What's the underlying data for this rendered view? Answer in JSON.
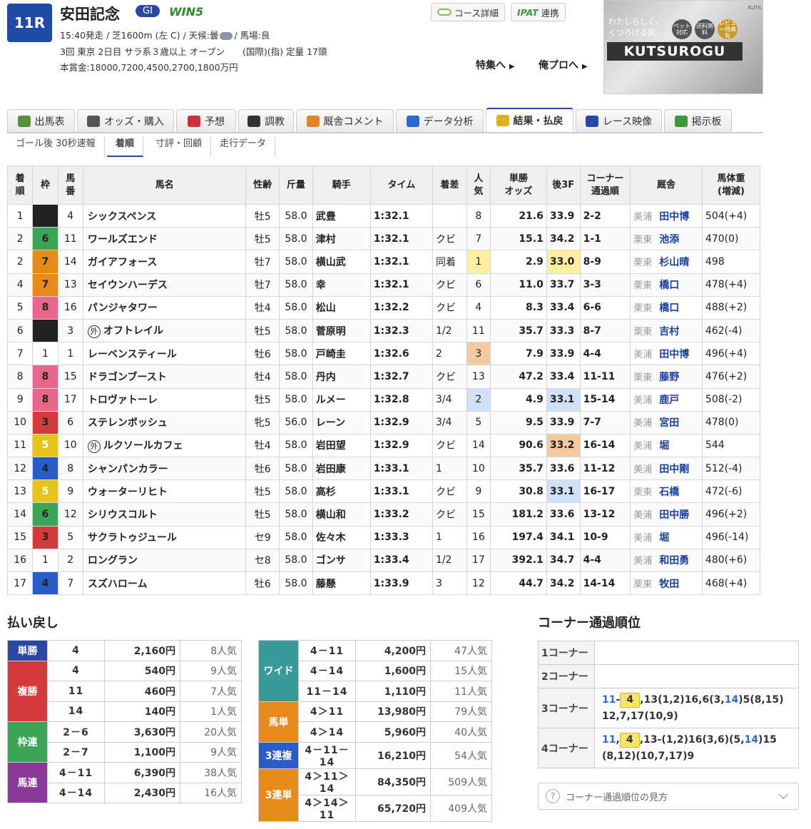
{
  "header": {
    "race_no": "11R",
    "race_name": "安田記念",
    "grade": "GI",
    "win5": "WIN5",
    "line1_pre": "15:40発走 / 芝1600m (左 C) / 天候:曇",
    "line1_post": "/ 馬場:良",
    "line2": "3回 東京 2日目 サラ系３歳以上 オープン　　(国際)(指) 定量 17頭",
    "line3": "本賞金:18000,7200,4500,2700,1800万円",
    "course_btn": "コース詳細",
    "ipat_logo": "IPAT",
    "ipat_btn": "連携",
    "feature_link": "特集へ",
    "orepro_link": "俺プロへ"
  },
  "ad": {
    "copy1": "わたしらしく、",
    "copy2": "くつろげる床。",
    "brand": "KUTSUROGU",
    "tag1": "ペット対応",
    "tag2": "送料無料",
    "tag3": "レビュー特典有",
    "side": "KUTS"
  },
  "tabs": [
    {
      "label": "出馬表",
      "color": "#5a8f3d"
    },
    {
      "label": "オッズ・購入",
      "color": "#555"
    },
    {
      "label": "予想",
      "color": "#d0303a"
    },
    {
      "label": "調教",
      "color": "#333"
    },
    {
      "label": "厩舎コメント",
      "color": "#e0852a"
    },
    {
      "label": "データ分析",
      "color": "#2a6ad0"
    },
    {
      "label": "結果・払戻",
      "color": "#e0b020"
    },
    {
      "label": "レース映像",
      "color": "#2a49a6"
    },
    {
      "label": "掲示板",
      "color": "#3a9a3a"
    }
  ],
  "subtabs": [
    "ゴール後 30秒速報",
    "着順",
    "寸評・回顧",
    "走行データ"
  ],
  "columns": [
    "着\n順",
    "枠",
    "馬\n番",
    "馬名",
    "性齢",
    "斤量",
    "騎手",
    "タイム",
    "着差",
    "人\n気",
    "単勝\nオッズ",
    "後3F",
    "コーナー\n通過順",
    "厩舎",
    "馬体重\n(増減)"
  ],
  "waku_colors": {
    "1": "#ffffff",
    "2": "#222222",
    "3": "#d63b3b",
    "4": "#2a5bc8",
    "5": "#e8c31a",
    "6": "#3aa655",
    "7": "#e88a1a",
    "8": "#e8668a"
  },
  "results": [
    {
      "pos": "1",
      "waku": "2",
      "num": "4",
      "name": "シックスペンス",
      "gai": false,
      "sex": "牡5",
      "wt": "58.0",
      "jockey": "武豊",
      "time": "1:32.1",
      "margin": "",
      "pop": "8",
      "odds": "21.6",
      "odds_red": false,
      "last3f": "33.9",
      "corner": "2-2",
      "region": "美浦",
      "trainer": "田中博",
      "bw": "504(+4)",
      "pop_hl": "",
      "f3_hl": ""
    },
    {
      "pos": "2",
      "waku": "6",
      "num": "11",
      "name": "ワールズエンド",
      "gai": false,
      "sex": "牡5",
      "wt": "58.0",
      "jockey": "津村",
      "time": "1:32.1",
      "margin": "クビ",
      "pop": "7",
      "odds": "15.1",
      "odds_red": false,
      "last3f": "34.2",
      "corner": "1-1",
      "region": "栗東",
      "trainer": "池添",
      "bw": "470(0)",
      "pop_hl": "",
      "f3_hl": ""
    },
    {
      "pos": "2",
      "waku": "7",
      "num": "14",
      "name": "ガイアフォース",
      "gai": false,
      "sex": "牡7",
      "wt": "58.0",
      "jockey": "横山武",
      "time": "1:32.1",
      "margin": "同着",
      "pop": "1",
      "odds": "2.9",
      "odds_red": true,
      "last3f": "33.0",
      "corner": "8-9",
      "region": "栗東",
      "trainer": "杉山晴",
      "bw": "498",
      "pop_hl": "y",
      "f3_hl": "y"
    },
    {
      "pos": "4",
      "waku": "7",
      "num": "13",
      "name": "セイウンハーデス",
      "gai": false,
      "sex": "牡7",
      "wt": "58.0",
      "jockey": "幸",
      "time": "1:32.1",
      "margin": "クビ",
      "pop": "6",
      "odds": "11.0",
      "odds_red": false,
      "last3f": "33.7",
      "corner": "3-3",
      "region": "栗東",
      "trainer": "橋口",
      "bw": "478(+4)",
      "pop_hl": "",
      "f3_hl": ""
    },
    {
      "pos": "5",
      "waku": "8",
      "num": "16",
      "name": "パンジャタワー",
      "gai": false,
      "sex": "牡4",
      "wt": "58.0",
      "jockey": "松山",
      "time": "1:32.2",
      "margin": "クビ",
      "pop": "4",
      "odds": "8.3",
      "odds_red": true,
      "last3f": "33.4",
      "corner": "6-6",
      "region": "栗東",
      "trainer": "橋口",
      "bw": "488(+2)",
      "pop_hl": "",
      "f3_hl": ""
    },
    {
      "pos": "6",
      "waku": "2",
      "num": "3",
      "name": "オフトレイル",
      "gai": true,
      "sex": "牡5",
      "wt": "58.0",
      "jockey": "菅原明",
      "time": "1:32.3",
      "margin": "1/2",
      "pop": "11",
      "odds": "35.7",
      "odds_red": false,
      "last3f": "33.3",
      "corner": "8-7",
      "region": "栗東",
      "trainer": "吉村",
      "bw": "462(-4)",
      "pop_hl": "",
      "f3_hl": ""
    },
    {
      "pos": "7",
      "waku": "1",
      "num": "1",
      "name": "レーベンスティール",
      "gai": false,
      "sex": "牡6",
      "wt": "58.0",
      "jockey": "戸崎圭",
      "time": "1:32.6",
      "margin": "2",
      "pop": "3",
      "odds": "7.9",
      "odds_red": true,
      "last3f": "33.9",
      "corner": "4-4",
      "region": "美浦",
      "trainer": "田中博",
      "bw": "496(+4)",
      "pop_hl": "o",
      "f3_hl": ""
    },
    {
      "pos": "8",
      "waku": "8",
      "num": "15",
      "name": "ドラゴンブースト",
      "gai": false,
      "sex": "牡4",
      "wt": "58.0",
      "jockey": "丹内",
      "time": "1:32.7",
      "margin": "クビ",
      "pop": "13",
      "odds": "47.2",
      "odds_red": false,
      "last3f": "33.4",
      "corner": "11-11",
      "region": "栗東",
      "trainer": "藤野",
      "bw": "476(+2)",
      "pop_hl": "",
      "f3_hl": ""
    },
    {
      "pos": "9",
      "waku": "8",
      "num": "17",
      "name": "トロヴァトーレ",
      "gai": false,
      "sex": "牡5",
      "wt": "58.0",
      "jockey": "ルメー",
      "time": "1:32.8",
      "margin": "3/4",
      "pop": "2",
      "odds": "4.9",
      "odds_red": true,
      "last3f": "33.1",
      "corner": "15-14",
      "region": "美浦",
      "trainer": "鹿戸",
      "bw": "508(-2)",
      "pop_hl": "b",
      "f3_hl": "b"
    },
    {
      "pos": "10",
      "waku": "3",
      "num": "6",
      "name": "ステレンボッシュ",
      "gai": false,
      "sex": "牝5",
      "wt": "56.0",
      "jockey": "レーン",
      "time": "1:32.9",
      "margin": "3/4",
      "pop": "5",
      "odds": "9.5",
      "odds_red": true,
      "last3f": "33.9",
      "corner": "7-7",
      "region": "美浦",
      "trainer": "宮田",
      "bw": "478(0)",
      "pop_hl": "",
      "f3_hl": ""
    },
    {
      "pos": "11",
      "waku": "5",
      "num": "10",
      "name": "ルクソールカフェ",
      "gai": true,
      "sex": "牡4",
      "wt": "58.0",
      "jockey": "岩田望",
      "time": "1:32.9",
      "margin": "クビ",
      "pop": "14",
      "odds": "90.6",
      "odds_red": false,
      "last3f": "33.2",
      "corner": "16-14",
      "region": "美浦",
      "trainer": "堀",
      "bw": "544",
      "pop_hl": "",
      "f3_hl": "o"
    },
    {
      "pos": "12",
      "waku": "4",
      "num": "8",
      "name": "シャンパンカラー",
      "gai": false,
      "sex": "牡6",
      "wt": "58.0",
      "jockey": "岩田康",
      "time": "1:33.1",
      "margin": "1",
      "pop": "10",
      "odds": "35.7",
      "odds_red": false,
      "last3f": "33.6",
      "corner": "11-12",
      "region": "美浦",
      "trainer": "田中剛",
      "bw": "512(-4)",
      "pop_hl": "",
      "f3_hl": ""
    },
    {
      "pos": "13",
      "waku": "5",
      "num": "9",
      "name": "ウォーターリヒト",
      "gai": false,
      "sex": "牡5",
      "wt": "58.0",
      "jockey": "高杉",
      "time": "1:33.1",
      "margin": "クビ",
      "pop": "9",
      "odds": "30.8",
      "odds_red": false,
      "last3f": "33.1",
      "corner": "16-17",
      "region": "栗東",
      "trainer": "石橋",
      "bw": "472(-6)",
      "pop_hl": "",
      "f3_hl": "b"
    },
    {
      "pos": "14",
      "waku": "6",
      "num": "12",
      "name": "シリウスコルト",
      "gai": false,
      "sex": "牡5",
      "wt": "58.0",
      "jockey": "横山和",
      "time": "1:33.2",
      "margin": "クビ",
      "pop": "15",
      "odds": "181.2",
      "odds_red": false,
      "last3f": "33.6",
      "corner": "13-12",
      "region": "美浦",
      "trainer": "田中勝",
      "bw": "496(+2)",
      "pop_hl": "",
      "f3_hl": ""
    },
    {
      "pos": "15",
      "waku": "3",
      "num": "5",
      "name": "サクラトゥジュール",
      "gai": false,
      "sex": "セ9",
      "wt": "58.0",
      "jockey": "佐々木",
      "time": "1:33.3",
      "margin": "1",
      "pop": "16",
      "odds": "197.4",
      "odds_red": false,
      "last3f": "34.1",
      "corner": "10-9",
      "region": "美浦",
      "trainer": "堀",
      "bw": "496(-14)",
      "pop_hl": "",
      "f3_hl": ""
    },
    {
      "pos": "16",
      "waku": "1",
      "num": "2",
      "name": "ロングラン",
      "gai": false,
      "sex": "セ8",
      "wt": "58.0",
      "jockey": "ゴンサ",
      "time": "1:33.4",
      "margin": "1/2",
      "pop": "17",
      "odds": "392.1",
      "odds_red": false,
      "last3f": "34.7",
      "corner": "4-4",
      "region": "美浦",
      "trainer": "和田勇",
      "bw": "480(+6)",
      "pop_hl": "",
      "f3_hl": ""
    },
    {
      "pos": "17",
      "waku": "4",
      "num": "7",
      "name": "スズハローム",
      "gai": false,
      "sex": "牡6",
      "wt": "58.0",
      "jockey": "藤懸",
      "time": "1:33.9",
      "margin": "3",
      "pop": "12",
      "odds": "44.7",
      "odds_red": false,
      "last3f": "34.2",
      "corner": "14-14",
      "region": "栗東",
      "trainer": "牧田",
      "bw": "468(+4)",
      "pop_hl": "",
      "f3_hl": ""
    }
  ],
  "gai_mark": "外",
  "payout_title": "払い戻し",
  "payouts_left": [
    {
      "type": "単勝",
      "color": "#2a49a6",
      "rows": [
        [
          "4",
          "2,160円",
          "8人気"
        ]
      ]
    },
    {
      "type": "複勝",
      "color": "#d63b3b",
      "rows": [
        [
          "4",
          "540円",
          "9人気"
        ],
        [
          "11",
          "460円",
          "7人気"
        ],
        [
          "14",
          "140円",
          "1人気"
        ]
      ]
    },
    {
      "type": "枠連",
      "color": "#3aa655",
      "rows": [
        [
          "2－6",
          "3,630円",
          "20人気"
        ],
        [
          "2－7",
          "1,100円",
          "9人気"
        ]
      ]
    },
    {
      "type": "馬連",
      "color": "#8a3a9a",
      "rows": [
        [
          "4－11",
          "6,390円",
          "38人気"
        ],
        [
          "4－14",
          "2,430円",
          "16人気"
        ]
      ]
    }
  ],
  "payouts_right": [
    {
      "type": "ワイド",
      "color": "#3a9a9a",
      "rows": [
        [
          "4－11",
          "4,200円",
          "47人気"
        ],
        [
          "4－14",
          "1,600円",
          "15人気"
        ],
        [
          "11－14",
          "1,110円",
          "11人気"
        ]
      ]
    },
    {
      "type": "馬単",
      "color": "#e88a1a",
      "rows": [
        [
          "4＞11",
          "13,980円",
          "79人気"
        ],
        [
          "4＞14",
          "5,960円",
          "40人気"
        ]
      ]
    },
    {
      "type": "3連複",
      "color": "#2a5bc8",
      "rows": [
        [
          "4－11－14",
          "16,210円",
          "54人気"
        ]
      ]
    },
    {
      "type": "3連単",
      "color": "#e88a1a",
      "rows": [
        [
          "4＞11＞14",
          "84,350円",
          "509人気"
        ],
        [
          "4＞14＞11",
          "65,720円",
          "409人気"
        ]
      ]
    }
  ],
  "corner_title": "コーナー通過順位",
  "corners": [
    {
      "label": "1コーナー",
      "segs": []
    },
    {
      "label": "2コーナー",
      "segs": []
    },
    {
      "label": "3コーナー",
      "segs": [
        {
          "t": "11",
          "c": "blue"
        },
        {
          "t": "-",
          "c": ""
        },
        {
          "t": "4",
          "c": "badge"
        },
        {
          "t": ",13(1,2)16,6(3,",
          "c": ""
        },
        {
          "t": "14",
          "c": "blue"
        },
        {
          "t": ")5(8,15)",
          "c": ""
        },
        {
          "t": "br",
          "c": "br"
        },
        {
          "t": "12,7,17(10,9)",
          "c": ""
        }
      ]
    },
    {
      "label": "4コーナー",
      "segs": [
        {
          "t": "11",
          "c": "blue"
        },
        {
          "t": ",",
          "c": ""
        },
        {
          "t": "4",
          "c": "badge"
        },
        {
          "t": ",13-(1,2)16(3,6)(5,",
          "c": ""
        },
        {
          "t": "14",
          "c": "blue"
        },
        {
          "t": ")15",
          "c": ""
        },
        {
          "t": "br",
          "c": "br"
        },
        {
          "t": "(8,12)(10,7,17)9",
          "c": ""
        }
      ]
    }
  ],
  "corner_howto": "コーナー通過順位の見方"
}
